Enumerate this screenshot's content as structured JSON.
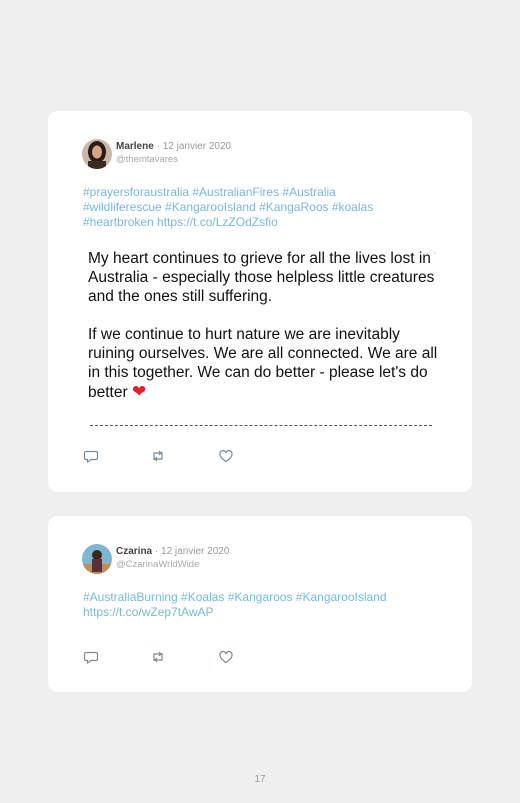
{
  "tweets": [
    {
      "author": "Marlene",
      "separator": "·",
      "date": "12 janvier 2020",
      "handle": "@themtavares",
      "text_lines": [
        "#prayersforaustralia #AustralianFires #Australia",
        "#wildliferescue #KangarooIsland #KangaRoos #koalas",
        "#heartbroken https://t.co/LzZOdZsfio"
      ],
      "embedded_image": {
        "paragraph1": "My heart continues to grieve for all the lives lost in Australia - especially those helpless little creatures and the ones still suffering.",
        "paragraph2": "If we continue to hurt nature we are inevitably ruining ourselves. We are all connected. We are all in this together. We can do better - please let's do better"
      },
      "icons": [
        "reply-icon",
        "retweet-icon",
        "like-icon"
      ]
    },
    {
      "author": "Czarina",
      "separator": "·",
      "date": "12 janvier 2020",
      "handle": "@CzarinaWrldWide",
      "text_lines": [
        "#AustraliaBurning #Koalas #Kangaroos #KangarooIsland",
        "https://t.co/wZep7tAwAP"
      ],
      "icons": [
        "reply-icon",
        "retweet-icon",
        "like-icon"
      ]
    }
  ],
  "page_number": "17",
  "colors": {
    "link": "#78b8e0",
    "background": "#efefef",
    "card": "#ffffff",
    "heart": "#e0202e"
  }
}
